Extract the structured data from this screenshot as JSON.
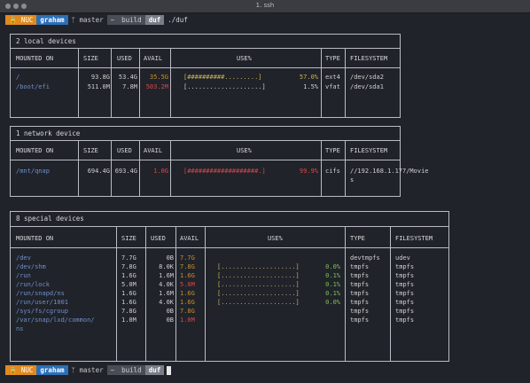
{
  "window": {
    "title": "1. ssh"
  },
  "prompt_top": {
    "host": "NUC",
    "user": "graham",
    "branch": "master",
    "path": [
      "~",
      "build"
    ],
    "current": "duf",
    "command": "./duf"
  },
  "prompt_bottom": {
    "host": "NUC",
    "user": "graham",
    "branch": "master",
    "path": [
      "~",
      "build"
    ],
    "current": "duf"
  },
  "local": {
    "title": "2 local devices",
    "headers": [
      "MOUNTED ON",
      "SIZE",
      "USED",
      "AVAIL",
      "USE%",
      "TYPE",
      "FILESYSTEM"
    ],
    "rows": [
      {
        "mount": "/",
        "size": "93.8G",
        "used": "53.4G",
        "avail": "35.5G",
        "bar": "[##########.........]",
        "pct": "57.0%",
        "type": "ext4",
        "fs": "/dev/sda2"
      },
      {
        "mount": "/boot/efi",
        "size": "511.0M",
        "used": "7.8M",
        "avail": "503.2M",
        "bar": "[....................]",
        "pct": "1.5%",
        "type": "vfat",
        "fs": "/dev/sda1"
      }
    ]
  },
  "network": {
    "title": "1 network device",
    "headers": [
      "MOUNTED ON",
      "SIZE",
      "USED",
      "AVAIL",
      "USE%",
      "TYPE",
      "FILESYSTEM"
    ],
    "rows": [
      {
        "mount": "/mnt/qnap",
        "size": "694.4G",
        "used": "693.4G",
        "avail": "1.0G",
        "bar": "[###################.]",
        "pct": "99.9%",
        "type": "cifs",
        "fs": "//192.168.1.177/Movie",
        "fs2": "s"
      }
    ]
  },
  "special": {
    "title": "8 special devices",
    "headers": [
      "MOUNTED ON",
      "SIZE",
      "USED",
      "AVAIL",
      "USE%",
      "TYPE",
      "FILESYSTEM"
    ],
    "rows": [
      {
        "mount": "/dev",
        "size": "7.7G",
        "used": "0B",
        "avail": "7.7G",
        "bar": "",
        "pct": "",
        "type": "devtmpfs",
        "fs": "udev"
      },
      {
        "mount": "/dev/shm",
        "size": "7.8G",
        "used": "8.0K",
        "avail": "7.8G",
        "bar": "[....................]",
        "pct": "0.0%",
        "type": "tmpfs",
        "fs": "tmpfs"
      },
      {
        "mount": "/run",
        "size": "1.6G",
        "used": "1.6M",
        "avail": "1.6G",
        "bar": "[....................]",
        "pct": "0.1%",
        "type": "tmpfs",
        "fs": "tmpfs"
      },
      {
        "mount": "/run/lock",
        "size": "5.0M",
        "used": "4.0K",
        "avail": "5.0M",
        "bar": "[....................]",
        "pct": "0.1%",
        "type": "tmpfs",
        "fs": "tmpfs"
      },
      {
        "mount": "/run/snapd/ns",
        "size": "1.6G",
        "used": "1.6M",
        "avail": "1.6G",
        "bar": "[....................]",
        "pct": "0.1%",
        "type": "tmpfs",
        "fs": "tmpfs"
      },
      {
        "mount": "/run/user/1001",
        "size": "1.6G",
        "used": "4.0K",
        "avail": "1.6G",
        "bar": "[....................]",
        "pct": "0.0%",
        "type": "tmpfs",
        "fs": "tmpfs"
      },
      {
        "mount": "/sys/fs/cgroup",
        "size": "7.8G",
        "used": "0B",
        "avail": "7.8G",
        "bar": "",
        "pct": "",
        "type": "tmpfs",
        "fs": "tmpfs"
      },
      {
        "mount": "/var/snap/lxd/common/",
        "mount2": "ns",
        "size": "1.0M",
        "used": "0B",
        "avail": "1.0M",
        "bar": "",
        "pct": "",
        "type": "tmpfs",
        "fs": "tmpfs"
      }
    ]
  }
}
